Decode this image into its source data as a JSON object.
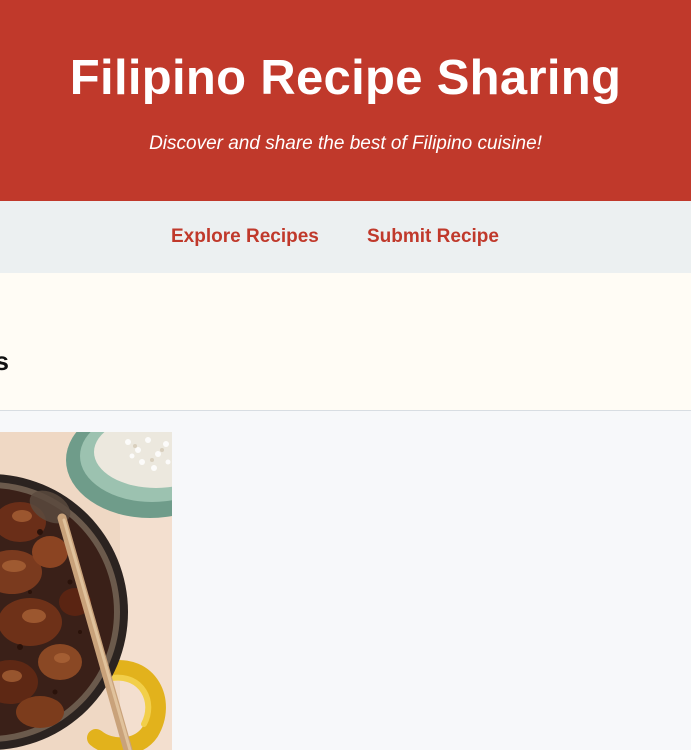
{
  "header": {
    "title": "Filipino Recipe Sharing",
    "tagline": "Discover and share the best of Filipino cuisine!"
  },
  "nav": {
    "items": [
      {
        "label": "Explore Recipes"
      },
      {
        "label": "Submit Recipe"
      }
    ]
  },
  "banner": {
    "heading_visible": "s"
  },
  "colors": {
    "brand_red": "#c0392b",
    "nav_bg": "#ecf0f1",
    "banner_bg": "#fffcf5",
    "page_bg": "#f7f8fa"
  }
}
